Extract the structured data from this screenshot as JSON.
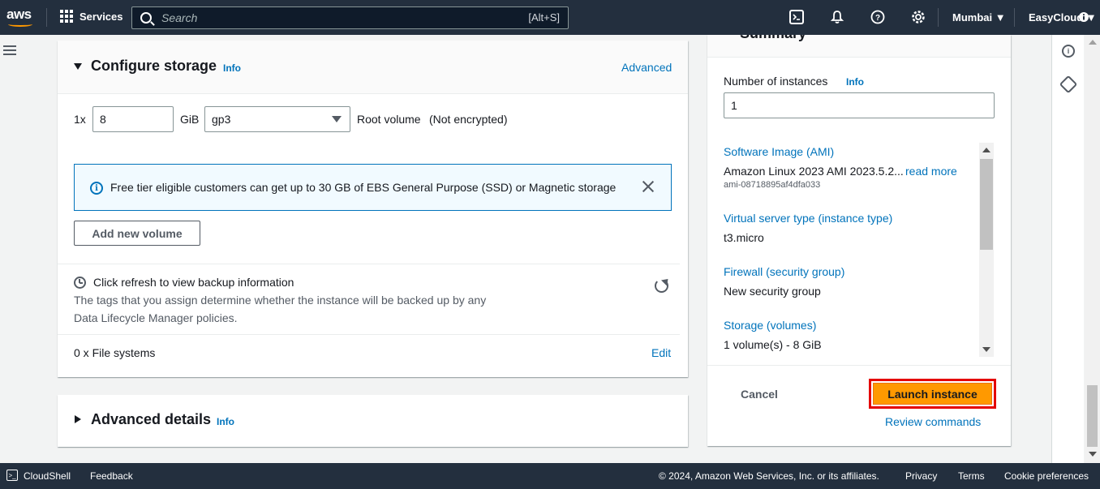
{
  "topnav": {
    "logo": "aws",
    "services": "Services",
    "search_placeholder": "Search",
    "search_shortcut": "[Alt+S]",
    "region": "Mumbai ▼",
    "account": "EasyCloud ▼"
  },
  "storage": {
    "title": "Configure storage",
    "info": "Info",
    "advanced": "Advanced",
    "multiplier": "1x",
    "size_value": "8",
    "size_unit": "GiB",
    "volume_type": "gp3",
    "root_label": "Root volume",
    "encryption": "(Not encrypted)",
    "alert_text": "Free tier eligible customers can get up to 30 GB of EBS General Purpose (SSD) or Magnetic storage",
    "add_volume": "Add new volume",
    "backup_title": "Click refresh to view backup information",
    "backup_desc_1": "The tags that you assign determine whether the instance will be backed up by any",
    "backup_desc_2": "Data Lifecycle Manager policies.",
    "file_systems": "0 x File systems",
    "edit": "Edit"
  },
  "advanced_details": {
    "title": "Advanced details",
    "info": "Info"
  },
  "summary": {
    "title": "Summary",
    "num_instances_label": "Number of instances",
    "info": "Info",
    "num_instances_value": "1",
    "ami_label": "Software Image (AMI)",
    "ami_value": "Amazon Linux 2023 AMI 2023.5.2...",
    "read_more": "read more",
    "ami_id": "ami-08718895af4dfa033",
    "type_label": "Virtual server type (instance type)",
    "type_value": "t3.micro",
    "firewall_label": "Firewall (security group)",
    "firewall_value": "New security group",
    "storage_label": "Storage (volumes)",
    "storage_value": "1 volume(s) - 8 GiB",
    "cancel": "Cancel",
    "launch": "Launch instance",
    "review": "Review commands"
  },
  "footer": {
    "cloudshell": "CloudShell",
    "feedback": "Feedback",
    "copyright": "© 2024, Amazon Web Services, Inc. or its affiliates.",
    "privacy": "Privacy",
    "terms": "Terms",
    "cookies": "Cookie preferences"
  }
}
